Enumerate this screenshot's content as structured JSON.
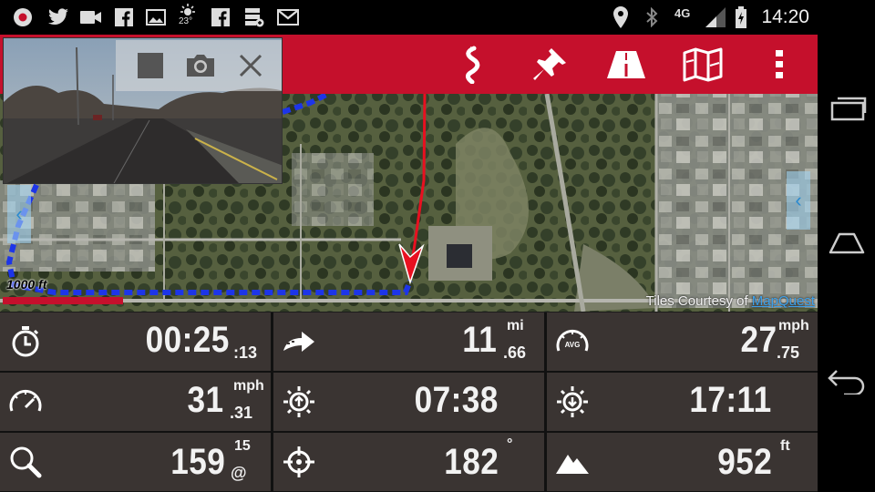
{
  "status_bar": {
    "time": "14:20",
    "temperature": "23°",
    "network": "4G",
    "left_icons": [
      "record-icon",
      "twitter-icon",
      "video-icon",
      "facebook-icon",
      "image-icon",
      "weather-sun-icon",
      "facebook-icon",
      "storage-icon",
      "gmail-icon"
    ],
    "right_icons": [
      "location-icon",
      "bluetooth-icon",
      "signal-icon",
      "battery-icon"
    ]
  },
  "toolbar": {
    "color": "#c5102c",
    "actions": [
      "route-icon",
      "pin-icon",
      "road-icon",
      "map-icon",
      "overflow-menu-icon"
    ]
  },
  "camera": {
    "controls": [
      "stop-icon",
      "camera-icon",
      "close-icon"
    ]
  },
  "map": {
    "scale_label": "1000 ft",
    "credit_prefix": "Tiles Courtesy of ",
    "credit_link": "MapQuest",
    "track_color": "#1d35e8",
    "route_color": "#e81020"
  },
  "stats": [
    {
      "name": "timer",
      "icon": "stopwatch-icon",
      "value": "00:25",
      "sub": ":13",
      "sup": ""
    },
    {
      "name": "distance",
      "icon": "distance-arrow-icon",
      "value": "11",
      "sub": ".66",
      "sup": "mi"
    },
    {
      "name": "avg-speed",
      "icon": "avg-speedometer-icon",
      "value": "27",
      "sub": ".75",
      "sup": "mph"
    },
    {
      "name": "speed",
      "icon": "speedometer-icon",
      "value": "31",
      "sub": ".31",
      "sup": "mph"
    },
    {
      "name": "sunrise",
      "icon": "sunrise-icon",
      "value": "07:38",
      "sub": "",
      "sup": ""
    },
    {
      "name": "sunset",
      "icon": "sunset-icon",
      "value": "17:11",
      "sub": "",
      "sup": ""
    },
    {
      "name": "accuracy",
      "icon": "search-icon",
      "value": "159",
      "sub": "@",
      "sup": "15"
    },
    {
      "name": "bearing",
      "icon": "crosshair-icon",
      "value": "182",
      "sub": "",
      "sup": "°"
    },
    {
      "name": "altitude",
      "icon": "mountain-icon",
      "value": "952",
      "sub": "",
      "sup": "ft"
    }
  ],
  "nav_bar": [
    "recent-apps-icon",
    "home-icon",
    "back-icon"
  ]
}
